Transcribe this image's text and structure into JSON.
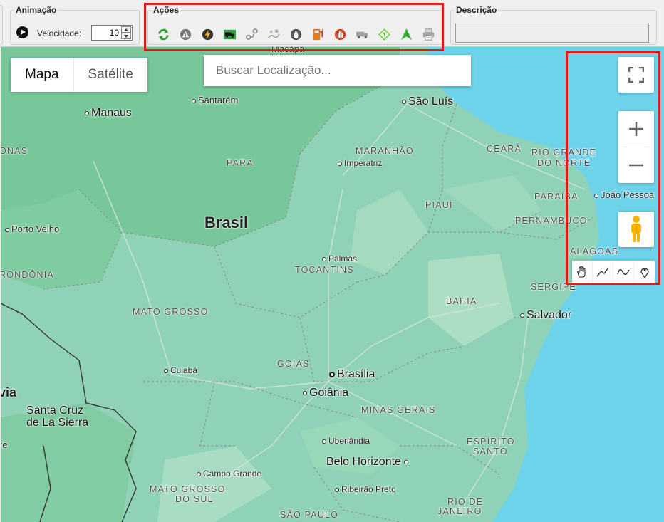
{
  "toolbar": {
    "animation": {
      "legend": "Animação",
      "speed_label": "Velocidade:",
      "speed_value": "10"
    },
    "actions": {
      "legend": "Ações",
      "icons": [
        "refresh-icon",
        "warning-icon",
        "lightning-icon",
        "truck-icon",
        "route-icon",
        "stops-icon",
        "drop-icon",
        "fuel-icon",
        "stop-hand-icon",
        "vehicle-icon",
        "tag-icon",
        "direction-icon",
        "print-icon"
      ]
    },
    "description": {
      "legend": "Descrição",
      "value": ""
    }
  },
  "map": {
    "map_type": {
      "map_label": "Mapa",
      "satellite_label": "Satélite"
    },
    "search_placeholder": "Buscar Localização...",
    "labels": {
      "macapa": "Macapá",
      "manaus": "Manaus",
      "santarem": "Santarém",
      "sao_luis": "São Luís",
      "amazonas": "ONAS",
      "para": "PARÁ",
      "maranhao": "MARANHÃO",
      "imperatriz": "Imperatriz",
      "ceara": "CEARÁ",
      "rio_grande_do_norte_1": "RIO GRANDE",
      "rio_grande_do_norte_2": "DO NORTE",
      "joao_pessoa": "João Pessoa",
      "paraiba": "PARAÍBA",
      "piaui": "PIAUÍ",
      "pernambuco": "PERNAMBUCO",
      "brasil": "Brasil",
      "porto_velho": "Porto Velho",
      "palmas": "Palmas",
      "tocantins": "TOCANTINS",
      "alagoas": "ALAGOAS",
      "rondonia": "RONDÔNIA",
      "sergipe": "SERGIPE",
      "bahia": "BAHIA",
      "mato_grosso": "MATO GROSSO",
      "salvador": "Salvador",
      "goias": "GOIÁS",
      "brasilia": "Brasília",
      "cuiaba": "Cuiabá",
      "bolivia": "via",
      "goiania": "Goiânia",
      "santa_cruz_1": "Santa Cruz",
      "santa_cruz_2": "de La Sierra",
      "minas_gerais": "MINAS GERAIS",
      "uberlandia": "Uberlândia",
      "espirito_santo_1": "ESPÍRITO",
      "espirito_santo_2": "SANTO",
      "belo_horizonte": "Belo Horizonte",
      "campo_grande": "Campo Grande",
      "mato_grosso_do_sul_1": "MATO GROSSO",
      "mato_grosso_do_sul_2": "DO SUL",
      "ribeirao_preto": "Ribeirão Preto",
      "rio_de_janeiro_1": "RIO DE",
      "rio_de_janeiro_2": "JANEIRO",
      "sao_paulo": "SÃO PAULO",
      "edge_re": "re"
    },
    "colors": {
      "land": "#8fd2b7",
      "forest": "#72c593",
      "ocean": "#6dd3ea",
      "highlight": "#e01b1b"
    }
  }
}
